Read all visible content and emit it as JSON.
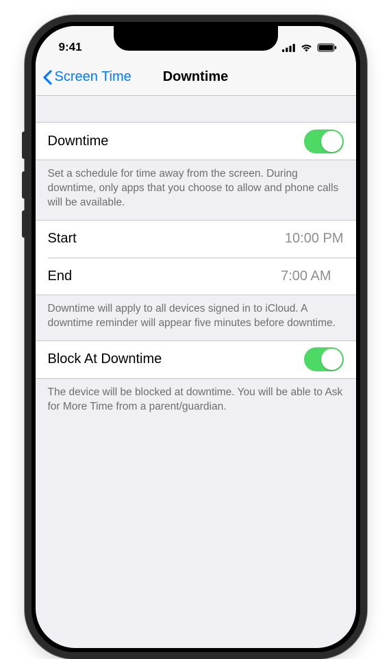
{
  "status": {
    "time": "9:41"
  },
  "nav": {
    "back_label": "Screen Time",
    "title": "Downtime"
  },
  "downtime": {
    "toggle_label": "Downtime",
    "toggle_on": true,
    "description": "Set a schedule for time away from the screen. During downtime, only apps that you choose to allow and phone calls will be available."
  },
  "schedule": {
    "start_label": "Start",
    "start_value": "10:00 PM",
    "end_label": "End",
    "end_value": "7:00 AM",
    "footer": "Downtime will apply to all devices signed in to iCloud. A downtime reminder will appear five minutes before downtime."
  },
  "block": {
    "label": "Block At Downtime",
    "on": true,
    "footer": "The device will be blocked at downtime. You will be able to Ask for More Time from a parent/guardian."
  }
}
